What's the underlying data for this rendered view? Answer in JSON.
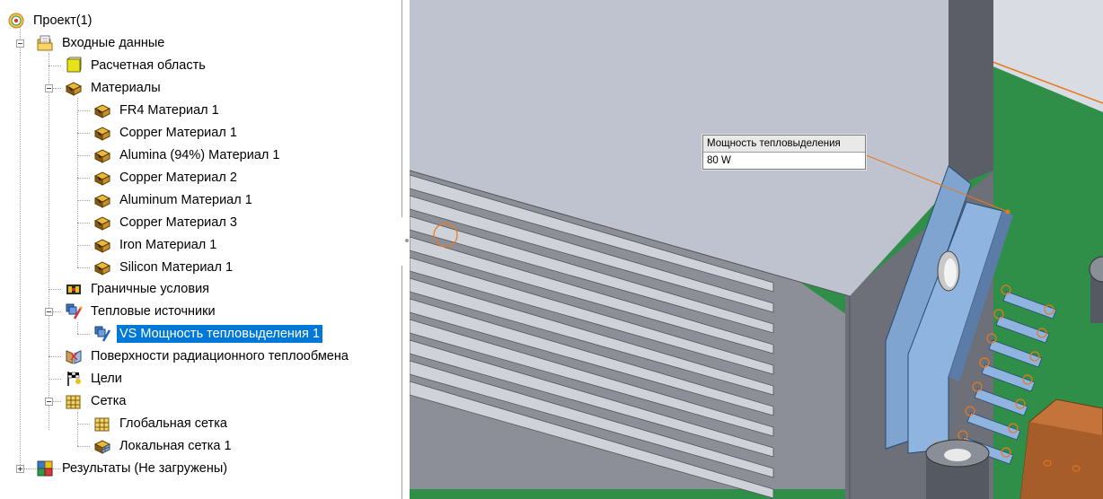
{
  "tree": {
    "project": "Проект(1)",
    "input_data": "Входные данные",
    "computational_domain": "Расчетная область",
    "materials": "Материалы",
    "material_items": [
      "FR4 Материал 1",
      "Copper Материал 1",
      "Alumina (94%) Материал 1",
      "Copper Материал 2",
      "Aluminum Материал 1",
      "Copper Материал 3",
      "Iron Материал 1",
      "Silicon Материал 1"
    ],
    "boundary_conditions": "Граничные условия",
    "heat_sources": "Тепловые источники",
    "heat_source_item": "VS Мощность тепловыделения 1",
    "radiative_surfaces": "Поверхности радиационного теплообмена",
    "goals": "Цели",
    "mesh": "Сетка",
    "global_mesh": "Глобальная сетка",
    "local_mesh": "Локальная сетка 1",
    "results": "Результаты (Не загружены)"
  },
  "callout": {
    "caption": "Мощность тепловыделения",
    "value": "80 W"
  },
  "colors": {
    "selection": "#0078d7",
    "pcb_green": "#2f8f48",
    "heatsink_gray": "#bfc2cf",
    "selected_face": "#8fb4e0",
    "highlight_orange": "#e8791b"
  }
}
